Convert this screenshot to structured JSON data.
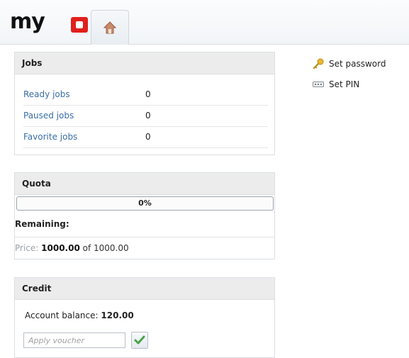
{
  "header": {
    "logo_text": "my",
    "home_tab_icon": "home-icon"
  },
  "jobs": {
    "title": "Jobs",
    "rows": [
      {
        "label": "Ready jobs",
        "value": "0"
      },
      {
        "label": "Paused jobs",
        "value": "0"
      },
      {
        "label": "Favorite jobs",
        "value": "0"
      }
    ]
  },
  "quota": {
    "title": "Quota",
    "progress_text": "0%",
    "progress_fraction": 0,
    "remaining_label": "Remaining:",
    "price_label": "Price:",
    "price_amount": "1000.00",
    "price_of": "of 1000.00"
  },
  "credit": {
    "title": "Credit",
    "balance_label": "Account balance:",
    "balance_value": "120.00",
    "voucher_placeholder": "Apply voucher",
    "voucher_button_icon": "checkmark-icon"
  },
  "side_links": {
    "set_password": "Set password",
    "set_pin": "Set PIN"
  },
  "colors": {
    "link": "#3a6ea5",
    "panel_header": "#ececec",
    "logo_red": "#e0201b",
    "check_green": "#4aa24a"
  }
}
